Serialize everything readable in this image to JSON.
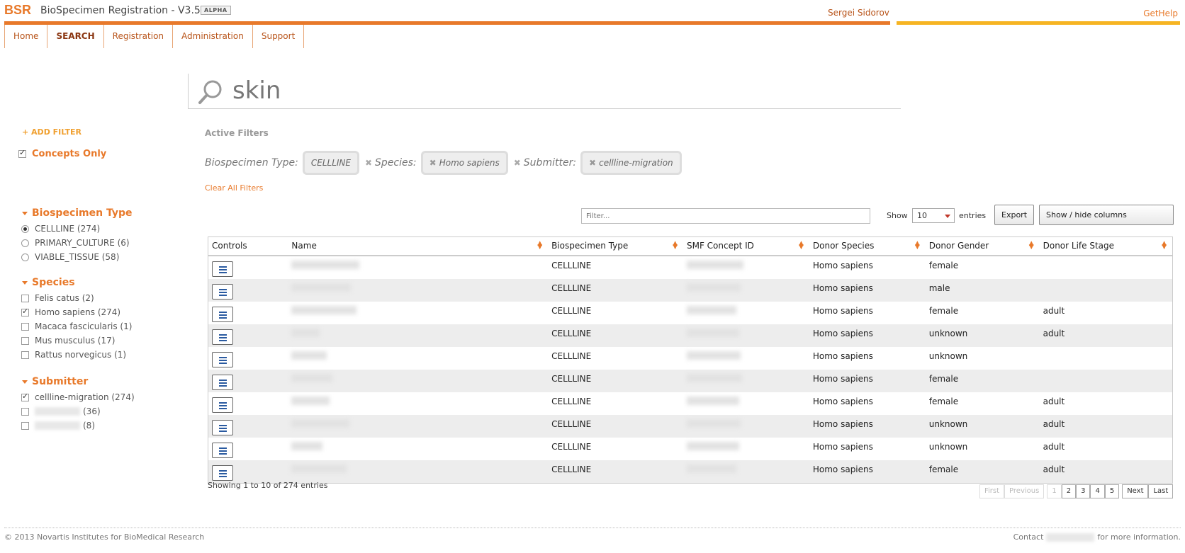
{
  "header": {
    "logo": "BSR",
    "title": "BioSpecimen Registration - V3.5",
    "badge": "ALPHA",
    "user": "Sergei Sidorov",
    "help": "GetHelp"
  },
  "nav": {
    "tabs": [
      {
        "label": "Home"
      },
      {
        "label": "SEARCH"
      },
      {
        "label": "Registration"
      },
      {
        "label": "Administration"
      },
      {
        "label": "Support"
      }
    ]
  },
  "search": {
    "query": "skin"
  },
  "sidebar": {
    "add_filter": "+ ADD FILTER",
    "concepts_only": "Concepts Only",
    "facets": [
      {
        "title": "Biospecimen Type",
        "items": [
          {
            "label": "CELLLINE (274)",
            "checked": true
          },
          {
            "label": "PRIMARY_CULTURE (6)",
            "checked": false
          },
          {
            "label": "VIABLE_TISSUE (58)",
            "checked": false
          }
        ]
      },
      {
        "title": "Species",
        "items": [
          {
            "label": "Felis catus (2)",
            "checked": false
          },
          {
            "label": "Homo sapiens (274)",
            "checked": true
          },
          {
            "label": "Macaca fascicularis (1)",
            "checked": false
          },
          {
            "label": "Mus musculus (17)",
            "checked": false
          },
          {
            "label": "Rattus norvegicus (1)",
            "checked": false
          }
        ]
      },
      {
        "title": "Submitter",
        "items": [
          {
            "label": "cellline-migration (274)",
            "checked": true
          },
          {
            "label": "(36)",
            "checked": false
          },
          {
            "label": "(8)",
            "checked": false
          }
        ]
      }
    ]
  },
  "active_filters": {
    "title": "Active Filters",
    "type_label": "Biospecimen Type:",
    "type_value": "CELLLINE",
    "species_label": "Species:",
    "species_value": "Homo sapiens",
    "submitter_label": "Submitter:",
    "submitter_value": "cellline-migration",
    "clear_all": "Clear All Filters"
  },
  "table_controls": {
    "filter_placeholder": "Filter...",
    "show": "Show",
    "page_size": "10",
    "entries": "entries",
    "export": "Export",
    "show_hide": "Show / hide columns"
  },
  "table": {
    "columns": [
      "Controls",
      "Name",
      "Biospecimen Type",
      "SMF Concept ID",
      "Donor Species",
      "Donor Gender",
      "Donor Life Stage"
    ],
    "rows": [
      {
        "type": "CELLLINE",
        "species": "Homo sapiens",
        "gender": "female",
        "stage": ""
      },
      {
        "type": "CELLLINE",
        "species": "Homo sapiens",
        "gender": "male",
        "stage": ""
      },
      {
        "type": "CELLLINE",
        "species": "Homo sapiens",
        "gender": "female",
        "stage": "adult"
      },
      {
        "type": "CELLLINE",
        "species": "Homo sapiens",
        "gender": "unknown",
        "stage": "adult"
      },
      {
        "type": "CELLLINE",
        "species": "Homo sapiens",
        "gender": "unknown",
        "stage": ""
      },
      {
        "type": "CELLLINE",
        "species": "Homo sapiens",
        "gender": "female",
        "stage": ""
      },
      {
        "type": "CELLLINE",
        "species": "Homo sapiens",
        "gender": "female",
        "stage": "adult"
      },
      {
        "type": "CELLLINE",
        "species": "Homo sapiens",
        "gender": "unknown",
        "stage": "adult"
      },
      {
        "type": "CELLLINE",
        "species": "Homo sapiens",
        "gender": "unknown",
        "stage": "adult"
      },
      {
        "type": "CELLLINE",
        "species": "Homo sapiens",
        "gender": "female",
        "stage": "adult"
      }
    ],
    "showing": "Showing 1 to 10 of 274 entries"
  },
  "pager": {
    "first": "First",
    "previous": "Previous",
    "pages": [
      "1",
      "2",
      "3",
      "4",
      "5"
    ],
    "next": "Next",
    "last": "Last"
  },
  "footer": {
    "copyright": "© 2013 Novartis Institutes for BioMedical Research",
    "contact_prefix": "Contact",
    "contact_suffix": "for more information."
  }
}
